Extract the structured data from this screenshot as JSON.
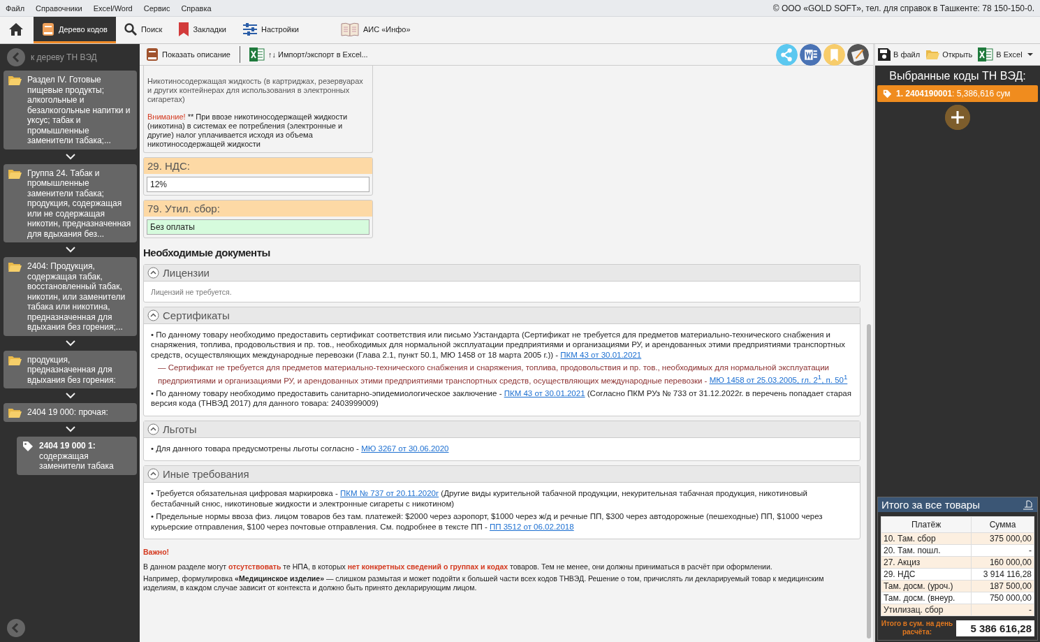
{
  "menu": [
    "Файл",
    "Справочники",
    "Excel/Word",
    "Сервис",
    "Справка"
  ],
  "copyright": "© ООО «GOLD SOFT», тел. для справок в Ташкенте: 78 150-150-0.",
  "tabs": [
    {
      "kind": "home",
      "selected": false
    },
    {
      "kind": "tree",
      "label": "Дерево кодов",
      "selected": true
    },
    {
      "kind": "search",
      "label": "Поиск",
      "selected": false
    },
    {
      "kind": "bookmark",
      "label": "Закладки",
      "selected": false
    },
    {
      "kind": "settings",
      "label": "Настройки",
      "selected": false
    },
    {
      "kind": "book",
      "label": "АИС «Инфо»",
      "selected": false
    }
  ],
  "sidebar": {
    "back": "к дереву ТН ВЭД",
    "items": [
      {
        "kind": "folder",
        "text": "Раздел IV. Готовые пищевые продукты; алкогольные и безалкогольные напитки и уксус; табак и промышленные заменители табака;..."
      },
      {
        "kind": "folder",
        "text": "Группа 24. Табак и промышленные заменители табака; продукция, содержащая или не содержащая никотин, предназначенная для вдыхания без..."
      },
      {
        "kind": "folder",
        "text": "2404: Продукция, содержащая табак, восстановленный табак, никотин, или заменители табака или никотина, предназначенная для вдыхания без горения;..."
      },
      {
        "kind": "folder",
        "text": "продукция, предназначенная для вдыхания без горения:"
      },
      {
        "kind": "folder",
        "text": "2404 19 000: прочая:"
      },
      {
        "kind": "tag",
        "text": "**2404 19 000 1:** содержащая заменители табака"
      }
    ]
  },
  "toolbar": {
    "buttons": [
      {
        "kind": "book",
        "label": "Показать описание"
      },
      {
        "kind": "excel",
        "label": "↑↓ Импорт/экспорт в Excel..."
      }
    ],
    "round_buttons": [
      {
        "kind": "share",
        "color": "#5bc8f0"
      },
      {
        "kind": "word",
        "color": "#4a73b5"
      },
      {
        "kind": "bookmark",
        "color": "#f7cc6a"
      },
      {
        "kind": "edit",
        "color": "#555555"
      }
    ]
  },
  "description": {
    "text": "Никотиносодержащая жидкость (в картриджах, резервуарах и других контейнерах для использования в электронных сигаретах)",
    "warning_label": "Внимание!",
    "warning_text": "** При ввозе никотиносодержащей жидкости (никотина) в системах ее потребления (электронные и другие) налог уплачивается исходя из объема никотиносодержащей жидкости"
  },
  "rates": [
    {
      "title": "29. НДС:",
      "value": "12%",
      "free": false
    },
    {
      "title": "79. Утил. сбор:",
      "value": "Без оплаты",
      "free": true
    }
  ],
  "documents": {
    "title": "Необходимые документы",
    "sections": [
      {
        "title": "Лицензии",
        "expanded": true,
        "empty": "Лицензий не требуется."
      },
      {
        "title": "Сертификаты",
        "expanded": true,
        "items": [
          {
            "kind": "bullet",
            "bullet": "•",
            "sep": "-",
            "text": "По данному товару необходимо предоставить сертификат соответствия или письмо Узстандарта (Сертификат не требуется для предметов материально-технического снабжения и снаряжения, топлива, продовольствия и пр. тов., необходимых для нормальной эксплуатации предприятиями и организациями РУ, и арендованных этими предприятиями транспортных средств, осуществляющих международные перевозки (Глава 2.1, пункт 50.1, МЮ 1458 от 18 марта 2005 г.))",
            "link": "ПКМ 43 от 30.01.2021"
          },
          {
            "kind": "note",
            "sep": "-",
            "text": "— Сертификат не требуется для предметов материально-технического снабжения и снаряжения, топлива, продовольствия и пр. тов., необходимых для нормальной эксплуатации предприятиями и организациями РУ, и арендованных этими предприятиями транспортных средств, осуществляющих международные перевозки",
            "link": "МЮ 1458 от 25.03.2005, гл. 2$^{1}$, п. 50$^{1}$"
          },
          {
            "kind": "bullet",
            "bullet": "•",
            "sep": "-",
            "text": "По данному товару необходимо предоставить санитарно-эпидемиологическое заключение",
            "link": "ПКМ 43 от 30.01.2021",
            "after": "(Согласно ПКМ РУз № 733 от 31.12.2022г. в перечень попадает старая версия кода (ТНВЭД 2017) для данного товара: 2403999009)"
          }
        ]
      },
      {
        "title": "Льготы",
        "expanded": true,
        "items": [
          {
            "kind": "bullet",
            "bullet": "•",
            "sep": "-",
            "text": "Для данного товара предусмотрены льготы согласно",
            "link": "МЮ 3267 от 30.06.2020"
          }
        ]
      },
      {
        "title": "Иные требования",
        "expanded": true,
        "items": [
          {
            "kind": "bullet",
            "bullet": "•",
            "sep": "-",
            "text": "Требуется обязательная цифровая маркировка",
            "link": "ПКМ № 737 от 20.11.2020г",
            "after": "(Другие виды курительной табачной продукции, некурительная табачная продукция, никотиновый бестабачный снюс, никотиновые жидкости и электронные сигареты с никотином)"
          },
          {
            "kind": "bullet",
            "bullet": "•",
            "sep": "-",
            "text": "Предельные нормы ввоза физ. лицом товаров без там. платежей: $2000 через аэропорт, $1000 через ж/д и речные ПП, $300 через автодорожные (пешеходные) ПП, $1000 через курьерские отправления, $100 через почтовые отправления. См. подробнее в тексте ПП",
            "link": "ПП 3512 от 06.02.2018"
          }
        ]
      }
    ]
  },
  "notice": {
    "title": "Важно!",
    "paragraphs": [
      {
        "segments": [
          {
            "kind": "plain",
            "text": "В данном разделе могут "
          },
          {
            "kind": "highlight",
            "text": "отсутствовать"
          },
          {
            "kind": "plain",
            "text": " те НПА, в которых "
          },
          {
            "kind": "highlight",
            "text": "нет конкретных сведений о группах и кодах"
          },
          {
            "kind": "plain",
            "text": " товаров. Тем не менее, они должны приниматься в расчёт при оформлении."
          }
        ]
      },
      {
        "text": "Например, формулировка **«Медицинское изделие»** — слишком размытая и может подойти к большей части всех кодов ТНВЭД. Решение о том, причислять ли декларируемый товар к медицинским изделиям, в каждом случае зависит от контекста и должно быть принято декларирующим лицом."
      }
    ]
  },
  "right_toolbar": [
    {
      "kind": "save",
      "label": "В файл"
    },
    {
      "kind": "folder",
      "label": "Открыть"
    },
    {
      "kind": "excel",
      "label": "В Excel",
      "dropdown": true
    }
  ],
  "selected_codes": {
    "title": "Выбранные коды ТН ВЭД:",
    "items": [
      {
        "text": "**1. 2404190001**: 5,386,616 сум",
        "selected": true
      }
    ]
  },
  "totals": {
    "title": "Итого за все товары",
    "columns": [
      "Платёж",
      "Сумма"
    ],
    "rows": [
      [
        "10. Там. сбор",
        "375 000,00"
      ],
      [
        "20. Там. пошл.",
        "-"
      ],
      [
        "27. Акциз",
        "160 000,00"
      ],
      [
        "29. НДС",
        "3 914 116,28"
      ],
      [
        "Там. досм. (уроч.)",
        "187 500,00"
      ],
      [
        "Там. досм. (внеур.",
        "750 000,00"
      ],
      [
        "Утилизац. сбор",
        "-"
      ]
    ],
    "total_label": "Итого в сум. на день расчёта:",
    "total_value": "5 386 616,28"
  }
}
